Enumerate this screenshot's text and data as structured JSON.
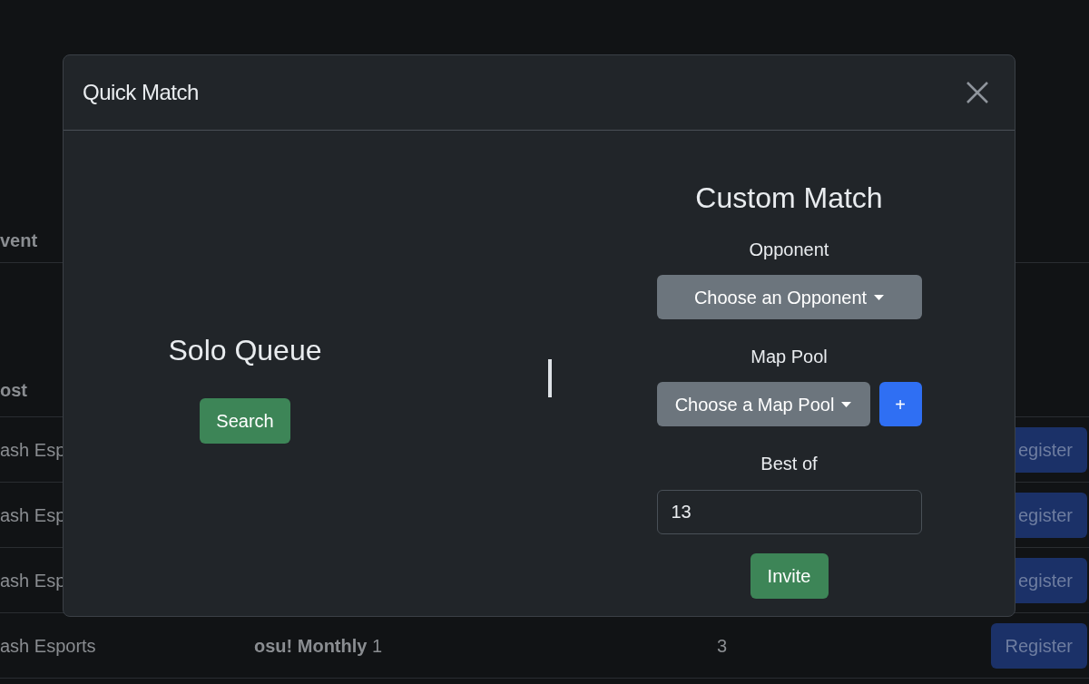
{
  "background_table": {
    "header_1": "vent",
    "header_2": "ost",
    "rows": [
      {
        "host": "ash Esp",
        "register": "egister"
      },
      {
        "host": "ash Esp",
        "register": "egister"
      },
      {
        "host": "ash Esp",
        "register": "egister"
      },
      {
        "host": "ash Esports",
        "event": "**osu! Monthly** 1",
        "column_3": "3",
        "register": "Register"
      }
    ]
  },
  "modal": {
    "title": "Quick Match",
    "solo": {
      "heading": "Solo Queue",
      "button": "Search"
    },
    "custom": {
      "heading": "Custom Match",
      "opponent_label": "Opponent",
      "opponent_dropdown": "Choose an Opponent",
      "map_pool_label": "Map Pool",
      "map_pool_dropdown": "Choose a Map Pool",
      "add_button": "+",
      "best_of_label": "Best of",
      "best_of_value": "13",
      "invite_button": "Invite"
    }
  }
}
